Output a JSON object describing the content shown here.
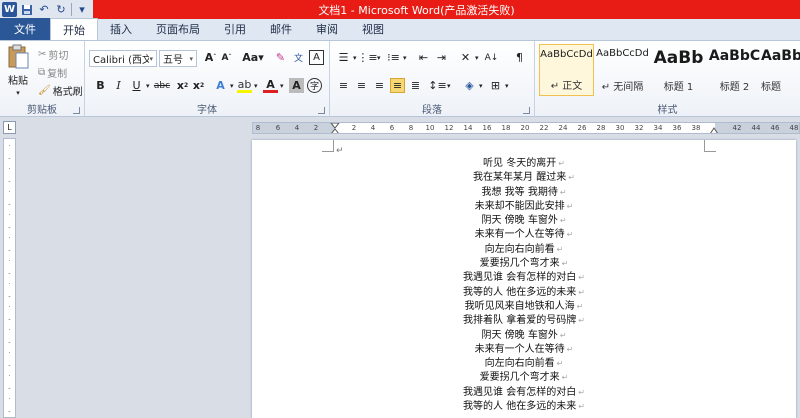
{
  "title": "文档1 - Microsoft Word(产品激活失败)",
  "tabs": [
    "文件",
    "开始",
    "插入",
    "页面布局",
    "引用",
    "邮件",
    "审阅",
    "视图"
  ],
  "clipboard": {
    "paste": "粘贴",
    "cut": "剪切",
    "copy": "复制",
    "format_painter": "格式刷",
    "label": "剪贴板"
  },
  "font": {
    "name": "Calibri (西文正",
    "size": "五号",
    "label": "字体"
  },
  "paragraph": {
    "label": "段落"
  },
  "styles": {
    "label": "样式",
    "items": [
      {
        "preview": "AaBbCcDd",
        "name": "↵ 正文"
      },
      {
        "preview": "AaBbCcDd",
        "name": "↵ 无间隔"
      },
      {
        "preview": "AaBb",
        "name": "标题 1"
      },
      {
        "preview": "AaBbC",
        "name": "标题 2"
      },
      {
        "preview": "AaBb",
        "name": "标题"
      }
    ]
  },
  "ruler": {
    "corner": "L",
    "ticks": [
      "8",
      "6",
      "4",
      "2",
      "2",
      "4",
      "6",
      "8",
      "10",
      "12",
      "14",
      "16",
      "18",
      "20",
      "22",
      "24",
      "26",
      "28",
      "30",
      "32",
      "34",
      "36",
      "38",
      "42",
      "44",
      "46",
      "48"
    ]
  },
  "document": {
    "para_mark": "↵",
    "lines": [
      "听见  冬天的离开",
      "我在某年某月  醒过来",
      "我想  我等  我期待",
      "未来却不能因此安排",
      "阴天  傍晚  车窗外",
      "未来有一个人在等待",
      "向左向右向前看",
      "爱要拐几个弯才来",
      "我遇见谁  会有怎样的对白",
      "我等的人  他在多远的未来",
      "我听见风来自地铁和人海",
      "我排着队  拿着爱的号码牌",
      "阴天  傍晚  车窗外",
      "未来有一个人在等待",
      "向左向右向前看",
      "爱要拐几个弯才来",
      "我遇见谁  会有怎样的对白",
      "我等的人  他在多远的未来"
    ]
  }
}
